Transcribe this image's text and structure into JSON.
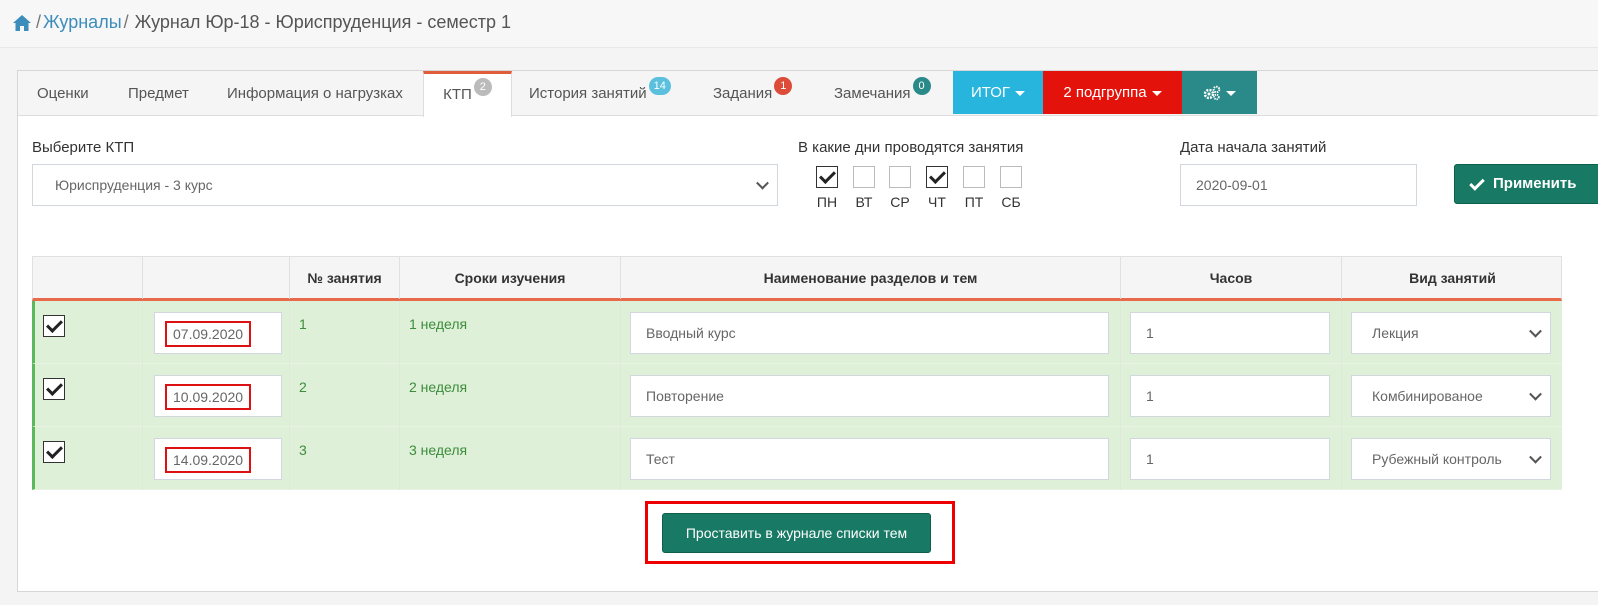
{
  "breadcrumb": {
    "home_icon": "home-icon",
    "journals_link": "Журналы",
    "current": "Журнал Юр-18 - Юриспруденция - семестр 1"
  },
  "tabs": [
    {
      "label": "Оценки"
    },
    {
      "label": "Предмет"
    },
    {
      "label": "Информация о нагрузках"
    },
    {
      "label": "КТП",
      "badge": "2"
    },
    {
      "label": "История занятий",
      "badge": "14"
    },
    {
      "label": "Задания",
      "badge": "1"
    },
    {
      "label": "Замечания",
      "badge": "0"
    }
  ],
  "tab_buttons": {
    "itog": "ИТОГ",
    "subgroup": "2 подгруппа",
    "settings_icon": "cogs-icon"
  },
  "colors": {
    "itog_bg": "#27b4dd",
    "subgroup_bg": "#e3120b",
    "settings_bg": "#2a8a8a",
    "accent": "#e05c3a",
    "success": "#187a64"
  },
  "ktp": {
    "label": "Выберите КТП",
    "selected": "Юриспруденция - 3 курс"
  },
  "days": {
    "label": "В какие дни проводятся занятия",
    "items": [
      {
        "label": "ПН",
        "checked": true
      },
      {
        "label": "ВТ",
        "checked": false
      },
      {
        "label": "СР",
        "checked": false
      },
      {
        "label": "ЧТ",
        "checked": true
      },
      {
        "label": "ПТ",
        "checked": false
      },
      {
        "label": "СБ",
        "checked": false
      }
    ]
  },
  "start_date": {
    "label": "Дата начала занятий",
    "value": "2020-09-01"
  },
  "apply_button": "Применить",
  "table": {
    "headers": [
      "",
      "",
      "№ занятия",
      "Сроки изучения",
      "Наименование разделов и тем",
      "Часов",
      "Вид занятий"
    ],
    "rows": [
      {
        "checked": true,
        "date": "07.09.2020",
        "num": "1",
        "term": "1 неделя",
        "topic": "Вводный курс",
        "hours": "1",
        "type": "Лекция"
      },
      {
        "checked": true,
        "date": "10.09.2020",
        "num": "2",
        "term": "2 неделя",
        "topic": "Повторение",
        "hours": "1",
        "type": "Комбинированое"
      },
      {
        "checked": true,
        "date": "14.09.2020",
        "num": "3",
        "term": "3 неделя",
        "topic": "Тест",
        "hours": "1",
        "type": "Рубежный контроль"
      }
    ]
  },
  "submit_button": "Проставить в журнале списки тем"
}
